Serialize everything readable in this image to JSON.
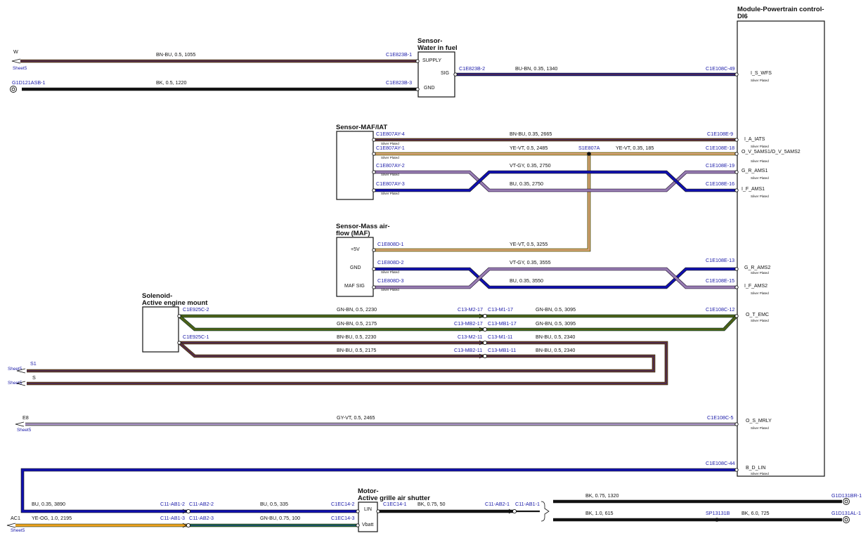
{
  "colors": {
    "BN-BU": [
      "#8a4a1a",
      "#101080"
    ],
    "BK": [
      "#111111",
      "#111111"
    ],
    "BU-BN": [
      "#1515a0",
      "#7a3a10"
    ],
    "YE-VT": [
      "#f0c020",
      "#b080e0"
    ],
    "VT-GY": [
      "#a070d0",
      "#909090"
    ],
    "BU": [
      "#1010b0",
      "#1010b0"
    ],
    "GN-BN": [
      "#3a8020",
      "#6a3a10"
    ],
    "GY-VT": [
      "#a0a0a8",
      "#b080e0"
    ],
    "YE-OG": [
      "#f0c020",
      "#f08020"
    ],
    "GN-BU": [
      "#2a8a30",
      "#1515a0"
    ]
  },
  "components": {
    "pcm": {
      "title_line1": "Module-Powertrain control-",
      "title_line2": "DI6"
    },
    "wif": {
      "title_line1": "Sensor-",
      "title_line2": "Water in fuel",
      "pins": [
        "SUPPLY",
        "SIG",
        "GND"
      ]
    },
    "maf_iat": {
      "title_line1": "Sensor-MAF/IAT"
    },
    "maf": {
      "title_line1": "Sensor-Mass air-",
      "title_line2": "flow (MAF)",
      "pins": [
        "+5V",
        "GND",
        "MAF SIG"
      ]
    },
    "sol": {
      "title_line1": "Solenoid-",
      "title_line2": "Active engine mount"
    },
    "motor": {
      "title_line1": "Motor-",
      "title_line2": "Active grille air shutter",
      "pins": [
        "LIN",
        "Vbatt"
      ]
    }
  },
  "pcm_pins": [
    {
      "label": "I_S_WFS",
      "sub": "Silver Plated"
    },
    {
      "label": "I_A_IATS",
      "sub": "Silver Plated"
    },
    {
      "label": "O_V_5AMS1/O_V_5AMS2",
      "sub": "Silver Plated"
    },
    {
      "label": "G_R_AMS1",
      "sub": "Silver Plated"
    },
    {
      "label": "I_F_AMS1",
      "sub": "Silver Plated"
    },
    {
      "label": "G_R_AMS2",
      "sub": "Silver Plated"
    },
    {
      "label": "I_F_AMS2",
      "sub": "Silver Plated"
    },
    {
      "label": "O_T_EMC",
      "sub": "Silver Plated"
    },
    {
      "label": "O_S_MRLY",
      "sub": "Silver Plated"
    },
    {
      "label": "B_D_LIN",
      "sub": "Silver Plated"
    }
  ],
  "wires": [
    {
      "id": "w1",
      "conn_left": "",
      "conn_right": "C1E823B-1",
      "spec": "BN-BU,  0.5,  1055",
      "code": "BN-BU"
    },
    {
      "id": "w2",
      "conn_left": "",
      "conn_right": "C1E823B-3",
      "spec": "BK,  0.5,  1220",
      "code": "BK"
    },
    {
      "id": "w3",
      "conn_left": "C1E823B-2",
      "conn_right": "C1E108C-49",
      "spec": "BU-BN,  0.35,  1340",
      "code": "BU-BN"
    },
    {
      "id": "w4",
      "conn_left": "C1E807AY-4",
      "conn_right": "C1E108E-9",
      "spec": "BN-BU,  0.35,  2665",
      "code": "BN-BU",
      "sub": "Silver Plated"
    },
    {
      "id": "w5",
      "conn_left": "C1E807AY-1",
      "conn_right": "",
      "spec": "YE-VT,  0.5,  2485",
      "code": "YE-VT",
      "sub": "Silver Plated"
    },
    {
      "id": "w5b",
      "conn_left": "S1E807A",
      "conn_right": "C1E108E-18",
      "spec": "YE-VT,  0.35,  185",
      "code": "YE-VT"
    },
    {
      "id": "w6",
      "conn_left": "C1E807AY-2",
      "conn_right": "C1E108E-19",
      "spec": "VT-GY,  0.35,  2750",
      "code": "VT-GY",
      "sub": "Silver Plated"
    },
    {
      "id": "w7",
      "conn_left": "C1E807AY-3",
      "conn_right": "C1E108E-16",
      "spec": "BU,  0.35,  2750",
      "code": "BU",
      "sub": "Silver Plated"
    },
    {
      "id": "w8",
      "conn_left": "C1E808D-1",
      "conn_right": "",
      "spec": "YE-VT,  0.5,  3255",
      "code": "YE-VT"
    },
    {
      "id": "w9",
      "conn_left": "C1E808D-2",
      "conn_right": "C1E108E-13",
      "spec": "VT-GY,  0.35,  3555",
      "code": "VT-GY",
      "sub": "Silver Plated"
    },
    {
      "id": "w10",
      "conn_left": "C1E808D-3",
      "conn_right": "C1E108E-15",
      "spec": "BU,  0.35,  3550",
      "code": "BU",
      "sub": "Silver Plated"
    },
    {
      "id": "w11",
      "conn_left": "C1E925C-2",
      "conn_right": "C13-M2-17",
      "spec": "GN-BN,  0.5,  2230",
      "code": "GN-BN"
    },
    {
      "id": "w11b",
      "conn_left": "C13-M1-17",
      "conn_right": "C1E108C-12",
      "spec": "GN-BN,  0.5,  3095",
      "code": "GN-BN"
    },
    {
      "id": "w12",
      "conn_left": "",
      "conn_right": "C13-MB2-17",
      "spec": "GN-BN,  0.5,  2175",
      "code": "GN-BN"
    },
    {
      "id": "w12b",
      "conn_left": "C13-MB1-17",
      "conn_right": "",
      "spec": "GN-BN,  0.5,  3095",
      "code": "GN-BN"
    },
    {
      "id": "w13",
      "conn_left": "C1E925C-1",
      "conn_right": "C13-M2-11",
      "spec": "BN-BU,  0.5,  2230",
      "code": "BN-BU"
    },
    {
      "id": "w13b",
      "conn_left": "C13-M1-11",
      "conn_right": "",
      "spec": "BN-BU,  0.5,  2340",
      "code": "BN-BU"
    },
    {
      "id": "w14",
      "conn_left": "",
      "conn_right": "C13-MB2-11",
      "spec": "BN-BU,  0.5,  2175",
      "code": "BN-BU"
    },
    {
      "id": "w14b",
      "conn_left": "C13-MB1-11",
      "conn_right": "",
      "spec": "BN-BU,  0.5,  2340",
      "code": "BN-BU"
    },
    {
      "id": "w15",
      "conn_left": "",
      "conn_right": "C1E108C-5",
      "spec": "GY-VT,  0.5,  2465",
      "code": "GY-VT"
    },
    {
      "id": "w16",
      "conn_left": "",
      "conn_right": "C1E108C-44",
      "spec": "",
      "code": "BU"
    },
    {
      "id": "w17",
      "conn_left": "",
      "conn_right": "C11-AB1-2",
      "spec": "BU,  0.35,  3890",
      "code": "BU"
    },
    {
      "id": "w17b",
      "conn_left": "C11-AB2-2",
      "conn_right": "C1EC14-2",
      "spec": "BU,  0.5,  335",
      "code": "BU"
    },
    {
      "id": "w18",
      "conn_left": "",
      "conn_right": "C11-AB1-3",
      "spec": "YE-OG,  1.0,  2195",
      "code": "YE-OG"
    },
    {
      "id": "w18b",
      "conn_left": "C11-AB2-3",
      "conn_right": "C1EC14-3",
      "spec": "GN-BU,  0.75,  100",
      "code": "GN-BU"
    },
    {
      "id": "w19",
      "conn_left": "C1EC14-1",
      "conn_right": "C11-AB2-1",
      "spec": "BK,  0.75,  50",
      "code": "BK"
    },
    {
      "id": "w19b",
      "conn_left": "C11-AB1-1",
      "conn_right": "",
      "spec": "",
      "code": "BK"
    },
    {
      "id": "w20",
      "conn_left": "",
      "conn_right": "G1D131BR-1",
      "spec": "BK,  0.75,  1320",
      "code": "BK"
    },
    {
      "id": "w21",
      "conn_left": "",
      "conn_right": "SP13131B",
      "spec": "BK,  1.0,  615",
      "code": "BK"
    },
    {
      "id": "w21b",
      "conn_left": "",
      "conn_right": "G1D131AL-1",
      "spec": "BK,  6.0,  725",
      "code": "BK"
    }
  ],
  "offsheet": [
    {
      "id": "o1",
      "label": "W",
      "sheet": "Sheet5"
    },
    {
      "id": "o2",
      "label": "S1",
      "sheet": "Sheet5"
    },
    {
      "id": "o3",
      "label": "S",
      "sheet": "Sheet5"
    },
    {
      "id": "o4",
      "label": "E8",
      "sheet": "Sheet5"
    },
    {
      "id": "o5",
      "label": "AC1",
      "sheet": "Sheet5"
    }
  ],
  "grounds": [
    {
      "id": "g1",
      "label": "G1D121ASB-1"
    }
  ]
}
